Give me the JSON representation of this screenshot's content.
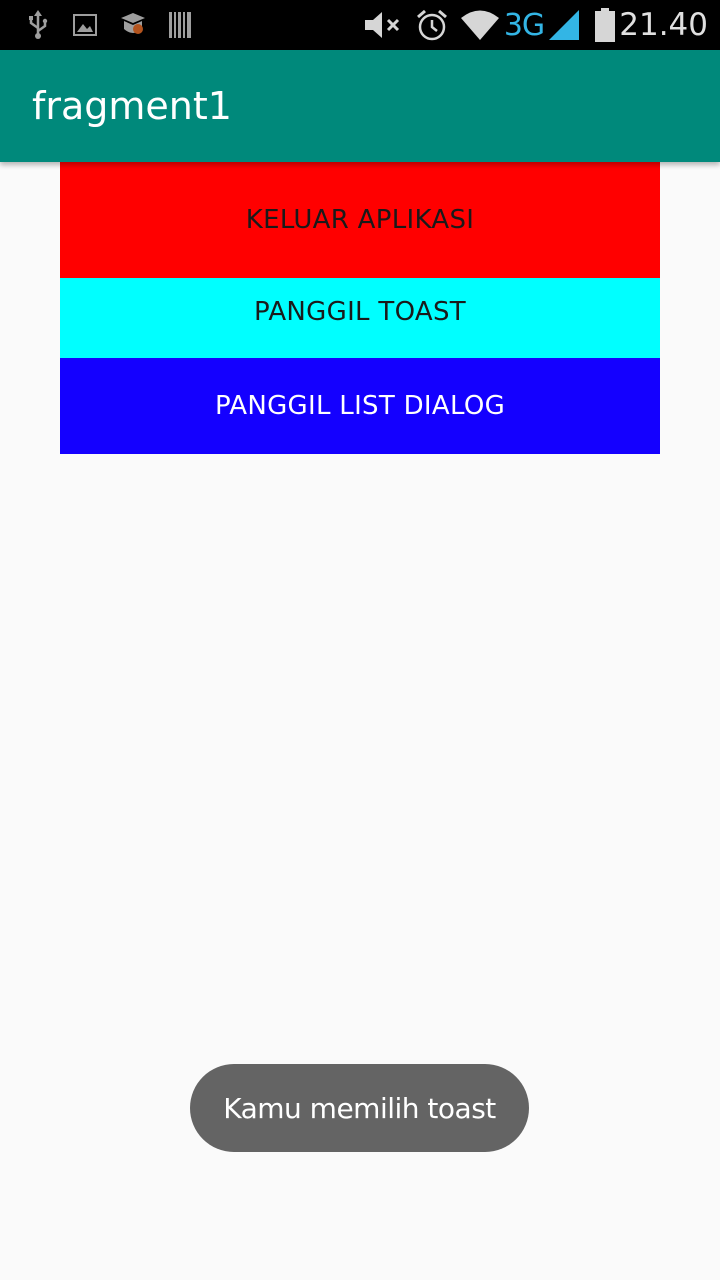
{
  "status_bar": {
    "time": "21.40",
    "network_type": "3G",
    "icons": [
      "usb-icon",
      "image-icon",
      "app-badge-icon",
      "barcode-icon",
      "mute-icon",
      "alarm-icon",
      "wifi-icon",
      "signal-icon",
      "battery-icon"
    ],
    "accent_color": "#33b5e5"
  },
  "app_bar": {
    "title": "fragment1",
    "color": "#00897b"
  },
  "buttons": {
    "keluar": {
      "label": "KELUAR APLIKASI",
      "color": "#ff0000"
    },
    "toast": {
      "label": "PANGGIL TOAST",
      "color": "#00ffff"
    },
    "list_dialog": {
      "label": "PANGGIL LIST DIALOG",
      "color": "#1400ff"
    }
  },
  "toast": {
    "message": "Kamu memilih toast"
  }
}
